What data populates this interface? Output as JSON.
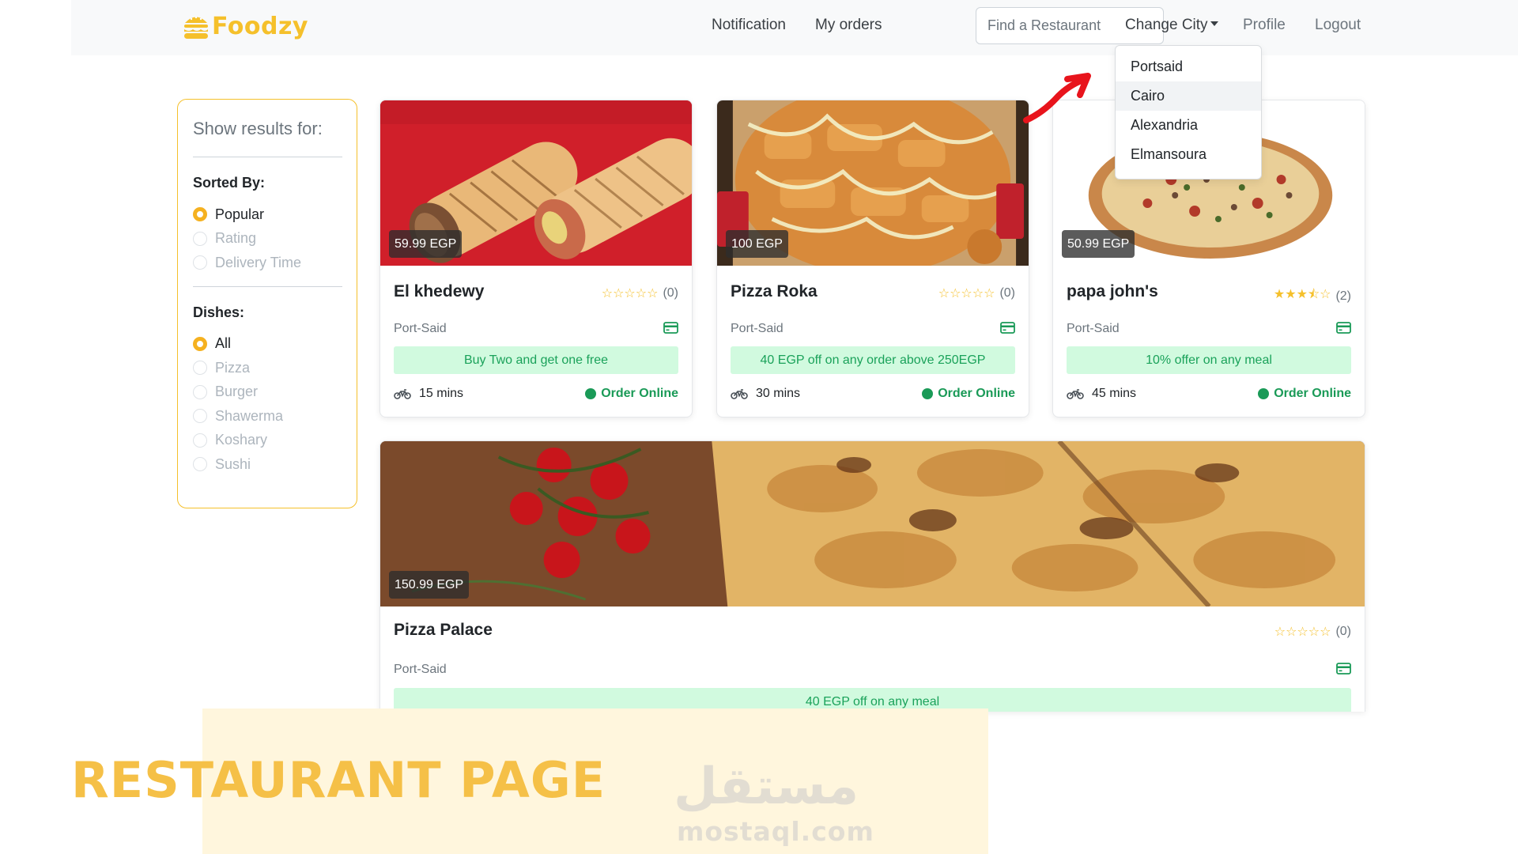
{
  "brand": {
    "name": "Foodzy",
    "color": "#f5c02b"
  },
  "nav": {
    "notification": "Notification",
    "my_orders": "My orders",
    "search_placeholder": "Find a Restaurant",
    "change_city": "Change City",
    "profile": "Profile",
    "logout": "Logout"
  },
  "city_dropdown": {
    "open": true,
    "items": [
      "Portsaid",
      "Cairo",
      "Alexandria",
      "Elmansoura"
    ],
    "highlighted": "Cairo"
  },
  "sidebar": {
    "title": "Show results for:",
    "sorted_by": {
      "heading": "Sorted By:",
      "options": [
        "Popular",
        "Rating",
        "Delivery Time"
      ],
      "selected": "Popular"
    },
    "dishes": {
      "heading": "Dishes:",
      "options": [
        "All",
        "Pizza",
        "Burger",
        "Shawerma",
        "Koshary",
        "Sushi"
      ],
      "selected": "All"
    }
  },
  "restaurants": [
    {
      "name": "El khedewy",
      "price": "59.99 EGP",
      "stars": 0,
      "reviews": "(0)",
      "location": "Port-Said",
      "offer": "Buy Two and get one free",
      "delivery": "15 mins",
      "status": "Order Online",
      "image": "shawarma-wraps"
    },
    {
      "name": "Pizza Roka",
      "price": "100 EGP",
      "stars": 0,
      "reviews": "(0)",
      "location": "Port-Said",
      "offer": "40 EGP off on any order above 250EGP",
      "delivery": "30 mins",
      "status": "Order Online",
      "image": "chicken-pizza-box"
    },
    {
      "name": "papa john's",
      "price": "50.99 EGP",
      "stars": 3.5,
      "reviews": "(2)",
      "location": "Port-Said",
      "offer": "10% offer on any meal",
      "delivery": "45 mins",
      "status": "Order Online",
      "image": "pizza-white-bg"
    },
    {
      "name": "Pizza Palace",
      "price": "150.99 EGP",
      "stars": 0,
      "reviews": "(0)",
      "location": "Port-Said",
      "offer": "40 EGP off on any meal",
      "image": "pizza-tomatoes-closeup"
    }
  ],
  "banner": {
    "title": "RESTAURANT PAGE",
    "watermark_ar": "مستقل",
    "watermark_en": "mostaql.com"
  },
  "colors": {
    "accent": "#f5c02b",
    "offer_bg": "#d1fadf",
    "offer_text": "#1aa25a",
    "online": "#1a9a57"
  },
  "icons": [
    "burger-logo-icon",
    "caret-down-icon",
    "red-arrow-icon",
    "credit-card-icon",
    "motorcycle-icon",
    "online-dot-icon",
    "star-icon"
  ]
}
